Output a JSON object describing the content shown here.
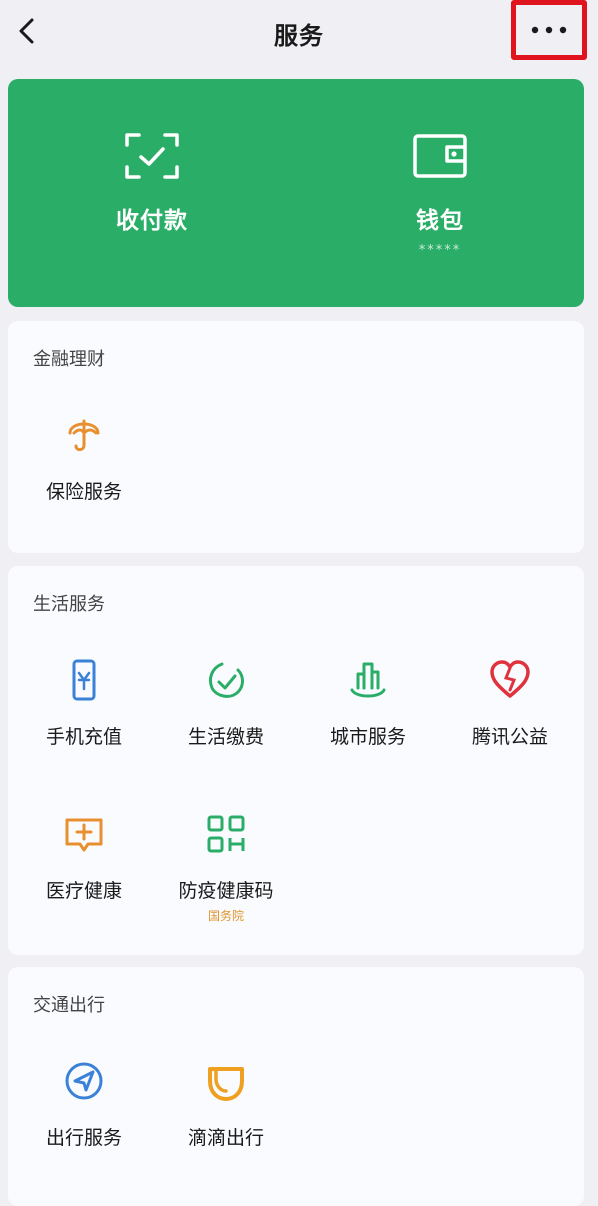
{
  "header": {
    "title": "服务",
    "back_icon": "chevron-left-icon",
    "more_icon": "more-dots-icon"
  },
  "wallet_card": {
    "background": "#2aae67",
    "items": [
      {
        "label": "收付款",
        "icon": "scan-pay-icon"
      },
      {
        "label": "钱包",
        "sub": "*****",
        "icon": "wallet-icon"
      }
    ]
  },
  "sections": [
    {
      "title": "金融理财",
      "items": [
        {
          "label": "保险服务",
          "icon": "insurance-umbrella-icon",
          "color": "#e8902f"
        }
      ]
    },
    {
      "title": "生活服务",
      "items": [
        {
          "label": "手机充值",
          "icon": "phone-recharge-icon",
          "color": "#3a82d8"
        },
        {
          "label": "生活缴费",
          "icon": "bill-payment-icon",
          "color": "#2aae67"
        },
        {
          "label": "城市服务",
          "icon": "city-service-icon",
          "color": "#2aae67"
        },
        {
          "label": "腾讯公益",
          "icon": "charity-heart-icon",
          "color": "#e0323c"
        },
        {
          "label": "医疗健康",
          "icon": "medical-health-icon",
          "color": "#e8902f"
        },
        {
          "label": "防疫健康码",
          "sub": "国务院",
          "icon": "health-qr-icon",
          "color": "#2aae67"
        }
      ]
    },
    {
      "title": "交通出行",
      "items": [
        {
          "label": "出行服务",
          "icon": "travel-compass-icon",
          "color": "#3a82d8"
        },
        {
          "label": "滴滴出行",
          "icon": "didi-icon",
          "color": "#f0a020"
        }
      ]
    }
  ]
}
